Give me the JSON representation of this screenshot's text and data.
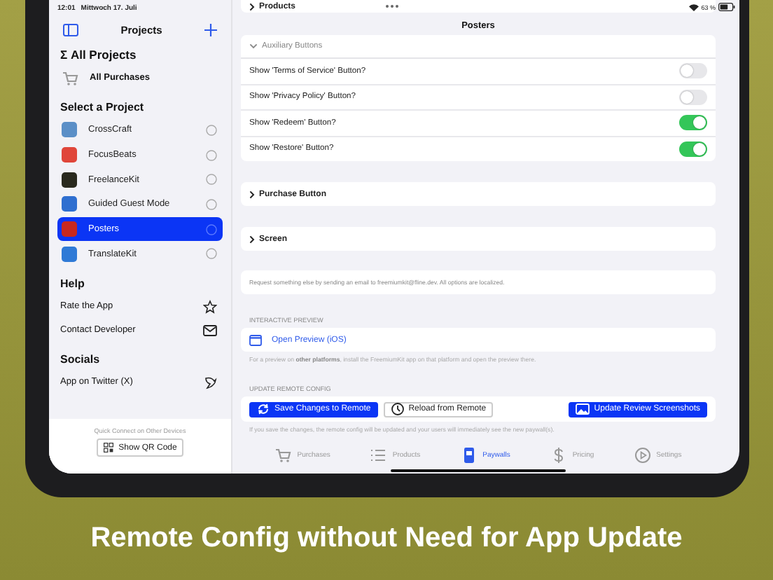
{
  "status_bar": {
    "time": "12:01",
    "date": "Mittwoch 17. Juli",
    "battery": "63 %"
  },
  "sidebar": {
    "title": "Projects",
    "all_projects_heading": "Σ All Projects",
    "all_purchases": "All Purchases",
    "select_heading": "Select a Project",
    "projects": [
      {
        "name": "CrossCraft",
        "selected": false,
        "color": "#5b8fc7"
      },
      {
        "name": "FocusBeats",
        "selected": false,
        "color": "#e0463a"
      },
      {
        "name": "FreelanceKit",
        "selected": false,
        "color": "#2a2a1e"
      },
      {
        "name": "Guided Guest Mode",
        "selected": false,
        "color": "#2f6fd0"
      },
      {
        "name": "Posters",
        "selected": true,
        "color": "#c8281e"
      },
      {
        "name": "TranslateKit",
        "selected": false,
        "color": "#2f7ad6"
      }
    ],
    "help_heading": "Help",
    "help_items": [
      {
        "label": "Rate the App",
        "kind": "star"
      },
      {
        "label": "Contact Developer",
        "kind": "mail"
      }
    ],
    "socials_heading": "Socials",
    "social_items": [
      {
        "label": "App on Twitter (X)",
        "kind": "bird"
      }
    ],
    "quick_connect": "Quick Connect on Other Devices",
    "qr_button": "Show QR Code"
  },
  "main": {
    "top_section": "Products",
    "title": "Posters",
    "auxiliary": {
      "title": "Auxiliary Buttons",
      "expanded": true,
      "toggles": [
        {
          "label": "Show 'Terms of Service' Button?",
          "on": false
        },
        {
          "label": "Show 'Privacy Policy' Button?",
          "on": false
        },
        {
          "label": "Show 'Redeem' Button?",
          "on": true
        },
        {
          "label": "Show 'Restore' Button?",
          "on": true
        }
      ]
    },
    "sections": [
      {
        "title": "Purchase Button",
        "expanded": false
      },
      {
        "title": "Screen",
        "expanded": false
      }
    ],
    "note": "Request something else by sending an email to freemiumkit@fline.dev. All options are localized.",
    "preview": {
      "heading": "INTERACTIVE PREVIEW",
      "link": "Open Preview (iOS)",
      "footnote": "For a preview on **other platforms**, install the FreemiumKit app on that platform and open the preview there."
    },
    "remote": {
      "heading": "UPDATE REMOTE CONFIG",
      "buttons": [
        {
          "label": "Save Changes to Remote",
          "kind": "primary"
        },
        {
          "label": "Reload from Remote",
          "kind": "secondary"
        },
        {
          "label": "Update Review Screenshots",
          "kind": "primary"
        }
      ],
      "footnote": "If you save the changes, the remote config will be updated and your users will immediately see the new paywall(s)."
    },
    "tabs": [
      {
        "label": "Purchases",
        "selected": false
      },
      {
        "label": "Products",
        "selected": false
      },
      {
        "label": "Paywalls",
        "selected": true
      },
      {
        "label": "Pricing",
        "selected": false
      },
      {
        "label": "Settings",
        "selected": false
      }
    ]
  },
  "caption": "Remote Config without Need for App Update"
}
